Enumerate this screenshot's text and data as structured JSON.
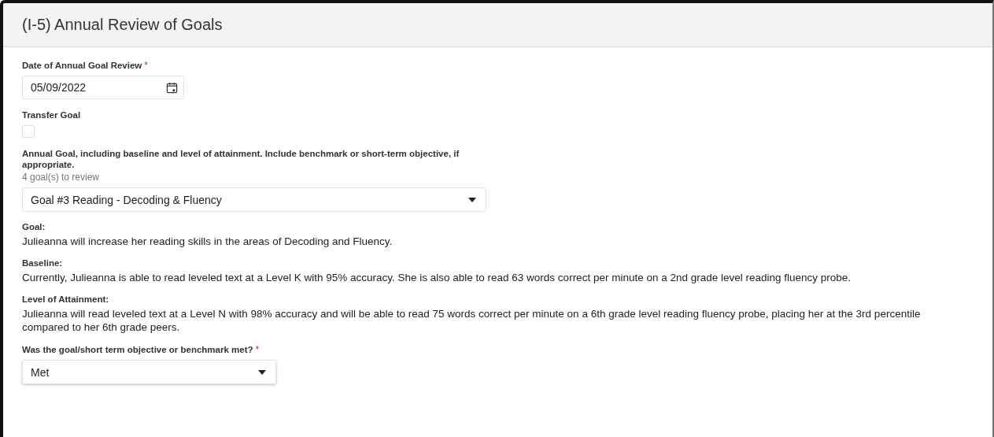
{
  "panel": {
    "title": "(I-5) Annual Review of Goals"
  },
  "date_field": {
    "label": "Date of Annual Goal Review",
    "required_mark": "*",
    "value": "05/09/2022"
  },
  "transfer_goal": {
    "label": "Transfer Goal",
    "checked": false
  },
  "goal_select": {
    "label": "Annual Goal, including baseline and level of attainment. Include benchmark or short-term objective, if appropriate.",
    "hint": "4 goal(s) to review",
    "value": "Goal #3 Reading - Decoding & Fluency"
  },
  "details": [
    {
      "label": "Goal:",
      "text": "Julieanna will increase her reading skills in the areas of Decoding and Fluency."
    },
    {
      "label": "Baseline:",
      "text": "Currently, Julieanna is able to read leveled text at a Level K with 95% accuracy. She is also able to read 63 words correct per minute on a 2nd grade level reading fluency probe."
    },
    {
      "label": "Level of Attainment:",
      "text": "Julieanna will read leveled text at a Level N with 98% accuracy and will be able to read 75 words correct per minute on a 6th grade level reading fluency probe, placing her at the 3rd percentile compared to her 6th grade peers."
    }
  ],
  "met_select": {
    "label": "Was the goal/short term objective or benchmark met?",
    "required_mark": "*",
    "value": "Met"
  }
}
